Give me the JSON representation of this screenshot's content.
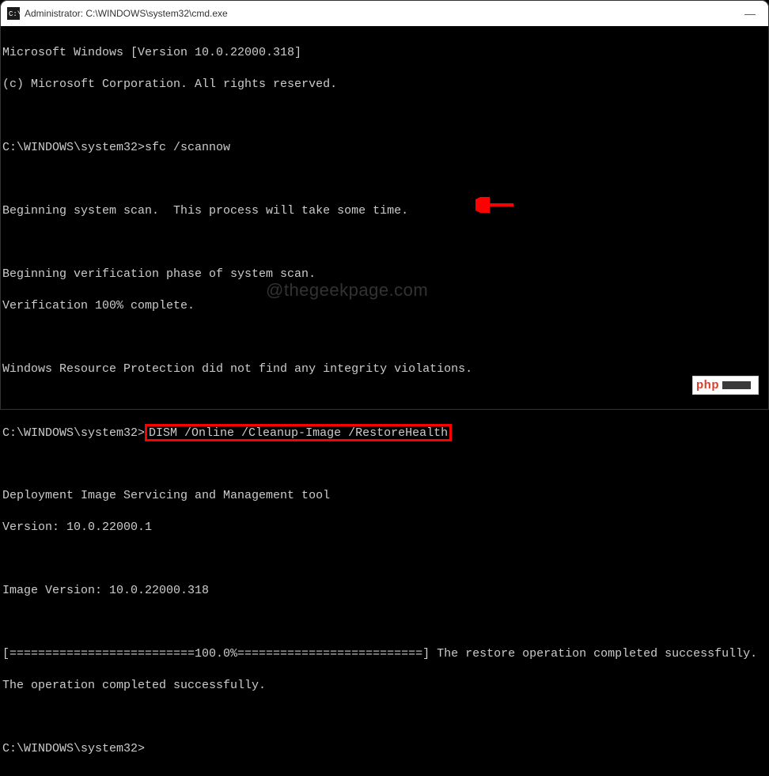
{
  "titlebar": {
    "title": "Administrator: C:\\WINDOWS\\system32\\cmd.exe"
  },
  "terminal": {
    "header_line1": "Microsoft Windows [Version 10.0.22000.318]",
    "header_line2": "(c) Microsoft Corporation. All rights reserved.",
    "prompt1_path": "C:\\WINDOWS\\system32>",
    "prompt1_cmd": "sfc /scannow",
    "scan_begin": "Beginning system scan.  This process will take some time.",
    "verify_begin": "Beginning verification phase of system scan.",
    "verify_complete": "Verification 100% complete.",
    "wrp_result": "Windows Resource Protection did not find any integrity violations.",
    "prompt2_path": "C:\\WINDOWS\\system32>",
    "prompt2_cmd": "DISM /Online /Cleanup-Image /RestoreHealth",
    "dism_title": "Deployment Image Servicing and Management tool",
    "dism_version": "Version: 10.0.22000.1",
    "image_version": "Image Version: 10.0.22000.318",
    "progress_line": "[==========================100.0%==========================] The restore operation completed successfully.",
    "completed": "The operation completed successfully.",
    "prompt3_path": "C:\\WINDOWS\\system32>"
  },
  "watermark": "@thegeekpage.com",
  "badge": {
    "text": "php"
  }
}
